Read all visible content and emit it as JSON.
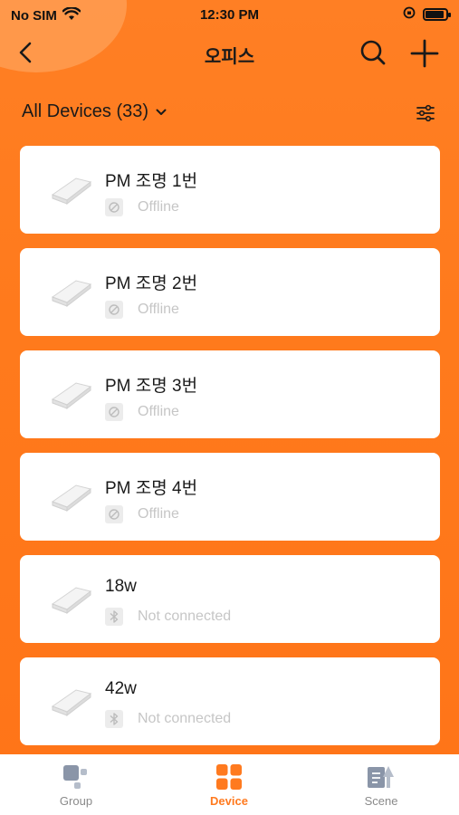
{
  "status_bar": {
    "carrier": "No SIM",
    "time": "12:30 PM"
  },
  "nav": {
    "title": "오피스"
  },
  "filter": {
    "label": "All Devices (33)"
  },
  "devices": [
    {
      "name": "PM 조명 1번",
      "status": "Offline",
      "status_icon": "offline-icon"
    },
    {
      "name": "PM 조명 2번",
      "status": "Offline",
      "status_icon": "offline-icon"
    },
    {
      "name": "PM 조명 3번",
      "status": "Offline",
      "status_icon": "offline-icon"
    },
    {
      "name": "PM 조명 4번",
      "status": "Offline",
      "status_icon": "offline-icon"
    },
    {
      "name": "18w",
      "status": "Not connected",
      "status_icon": "bluetooth-icon"
    },
    {
      "name": "42w",
      "status": "Not connected",
      "status_icon": "bluetooth-icon"
    }
  ],
  "tabs": [
    {
      "label": "Group",
      "icon": "group-icon",
      "active": false
    },
    {
      "label": "Device",
      "icon": "device-icon",
      "active": true
    },
    {
      "label": "Scene",
      "icon": "scene-icon",
      "active": false
    }
  ],
  "colors": {
    "accent": "#ff7a1f",
    "card": "#ffffff",
    "muted_text": "#c6c6c6"
  }
}
